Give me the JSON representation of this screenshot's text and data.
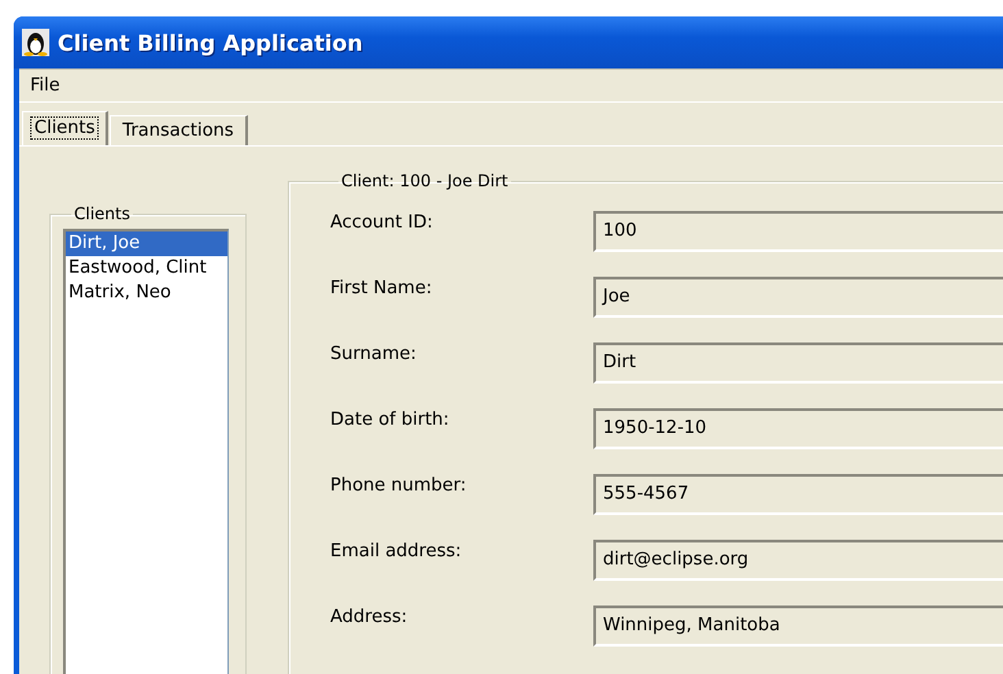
{
  "window": {
    "title": "Client Billing Application"
  },
  "menu": [
    "File"
  ],
  "tabs": [
    {
      "label": "Clients",
      "selected": true
    },
    {
      "label": "Transactions",
      "selected": false
    }
  ],
  "clients_group": {
    "title": "Clients",
    "items": [
      {
        "label": "Dirt, Joe",
        "selected": true
      },
      {
        "label": "Eastwood, Clint",
        "selected": false
      },
      {
        "label": "Matrix, Neo",
        "selected": false
      }
    ]
  },
  "details_group": {
    "title": "Client: 100 - Joe Dirt",
    "fields": [
      {
        "label": "Account ID:",
        "value": "100"
      },
      {
        "label": "First Name:",
        "value": "Joe"
      },
      {
        "label": "Surname:",
        "value": "Dirt"
      },
      {
        "label": "Date of birth:",
        "value": "1950-12-10"
      },
      {
        "label": "Phone number:",
        "value": "555-4567"
      },
      {
        "label": "Email address:",
        "value": "dirt@eclipse.org"
      },
      {
        "label": "Address:",
        "value": "Winnipeg, Manitoba"
      }
    ]
  }
}
